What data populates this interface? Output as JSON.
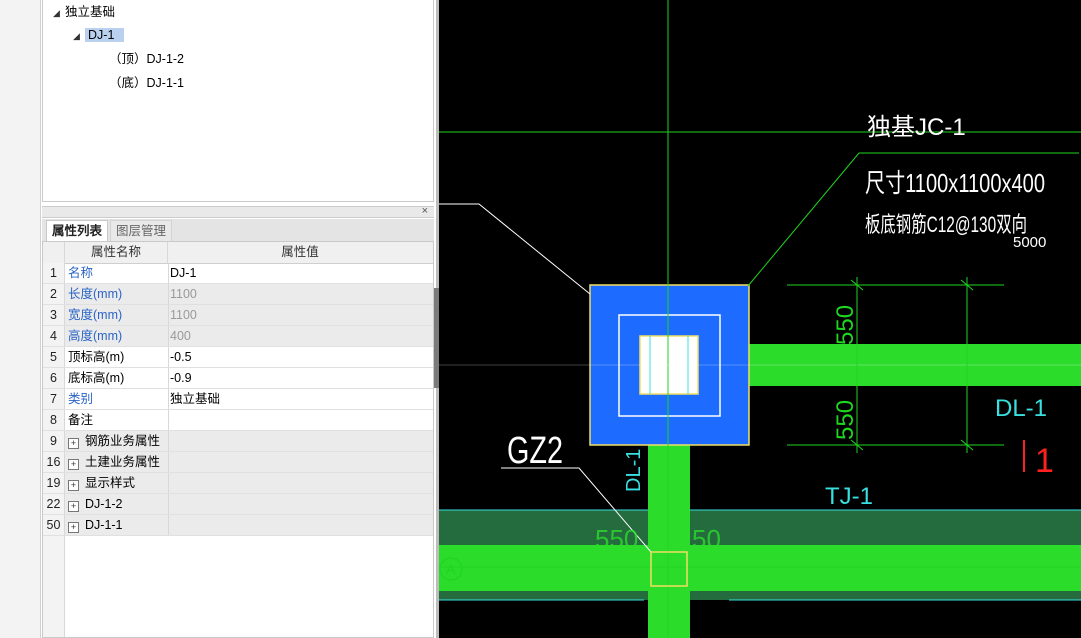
{
  "tree": {
    "root": "独立基础",
    "child": "DJ-1",
    "leaves": [
      "（顶）DJ-1-2",
      "（底）DJ-1-1"
    ]
  },
  "panel": {
    "close_glyph": "×"
  },
  "tabs": {
    "properties": "属性列表",
    "layers": "图层管理"
  },
  "grid": {
    "col_name": "属性名称",
    "col_value": "属性值",
    "rows": [
      {
        "num": "1",
        "name": "名称",
        "value": "DJ-1"
      },
      {
        "num": "2",
        "name": "长度(mm)",
        "value": "1100"
      },
      {
        "num": "3",
        "name": "宽度(mm)",
        "value": "1100"
      },
      {
        "num": "4",
        "name": "高度(mm)",
        "value": "400"
      },
      {
        "num": "5",
        "name": "顶标高(m)",
        "value": "-0.5"
      },
      {
        "num": "6",
        "name": "底标高(m)",
        "value": "-0.9"
      },
      {
        "num": "7",
        "name": "类别",
        "value": "独立基础"
      },
      {
        "num": "8",
        "name": "备注",
        "value": ""
      },
      {
        "num": "9",
        "name": "钢筋业务属性",
        "value": ""
      },
      {
        "num": "16",
        "name": "土建业务属性",
        "value": ""
      },
      {
        "num": "19",
        "name": "显示样式",
        "value": ""
      },
      {
        "num": "22",
        "name": "DJ-1-2",
        "value": ""
      },
      {
        "num": "50",
        "name": "DJ-1-1",
        "value": ""
      }
    ]
  },
  "cad": {
    "label_jc_title": "独基JC-1",
    "label_size": "尺寸1100x1100x400",
    "label_rebar": "板底钢筋C12@130双向",
    "label_5000": "5000",
    "label_gz2": "GZ2",
    "label_dl1_right": "DL-1",
    "label_dl1_vertical": "DL-1",
    "label_tj1": "TJ-1",
    "label_550_a": "550",
    "label_550_b": "550",
    "label_550_c": "550",
    "label_550_d": "50",
    "label_axis_a": "A",
    "label_red": "1",
    "colors": {
      "background": "#000000",
      "green_beam": "#2bdc2b",
      "dark_green_band": "#246b3e",
      "footing_blue": "#1e6bff",
      "dimension_green": "#1fd61f",
      "cyan_text": "#38e0e0",
      "white": "#ffffff",
      "yellow_outline": "#f0e060",
      "red": "#ff2020"
    }
  }
}
